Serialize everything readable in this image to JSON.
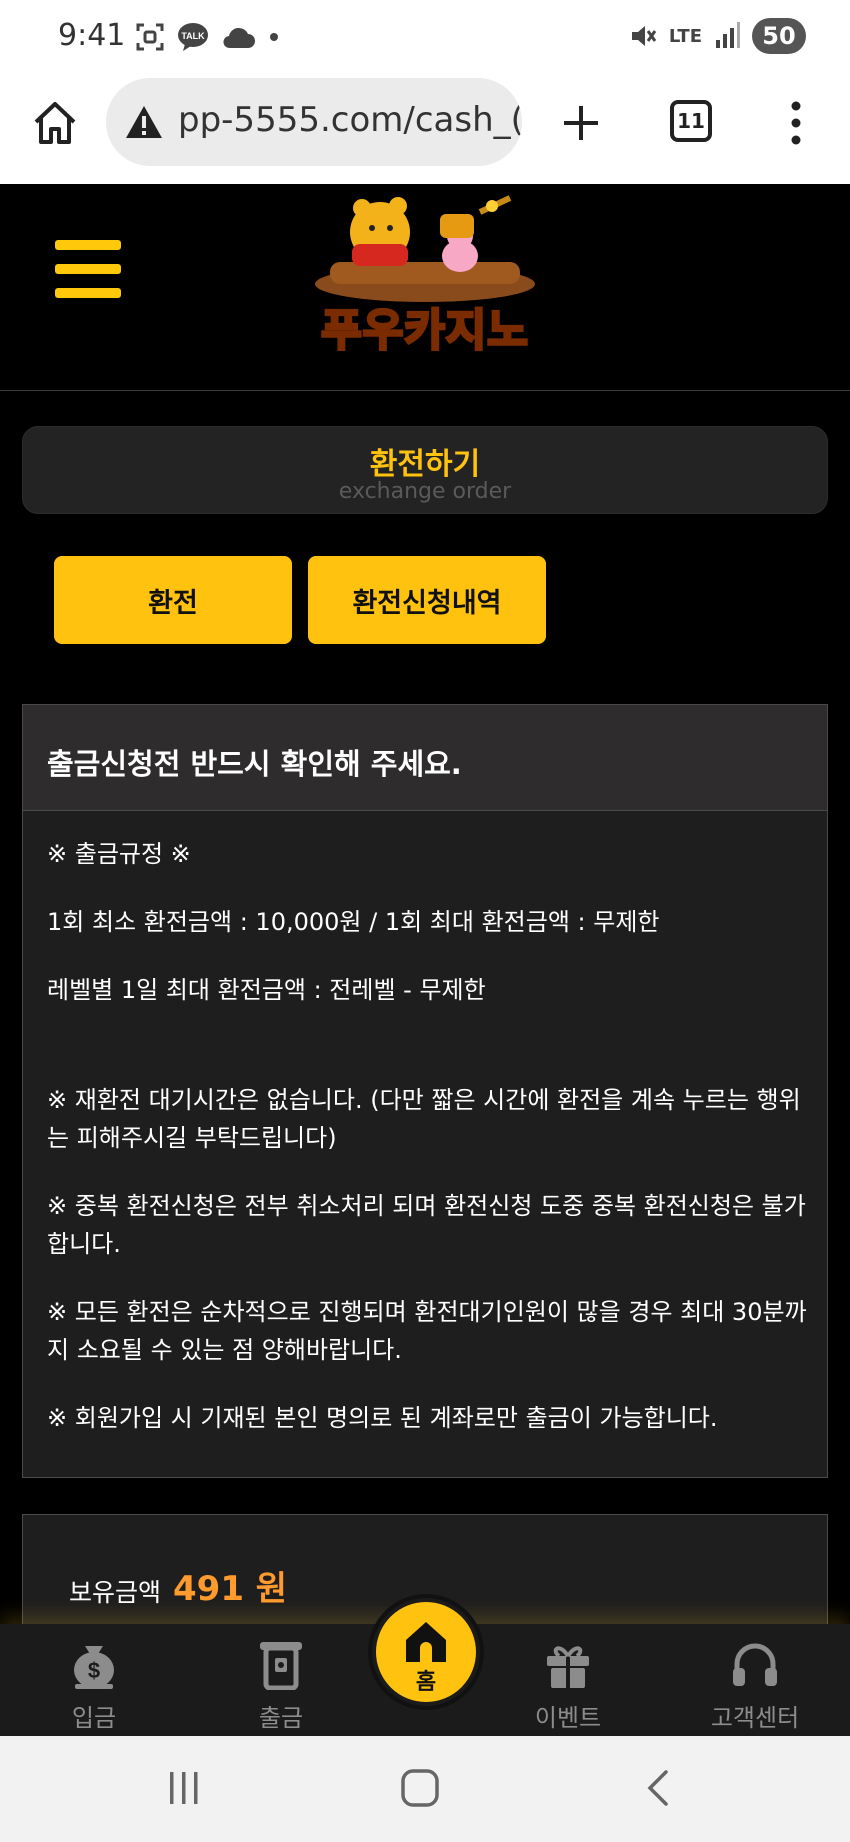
{
  "status_bar": {
    "time": "9:41",
    "talk_badge": "TALK",
    "network": "LTE",
    "battery": "50"
  },
  "browser": {
    "url": "pp-5555.com/cash_(",
    "tab_count": "11"
  },
  "site": {
    "logo_text": "푸우카지노"
  },
  "page": {
    "title": "환전하기",
    "subtitle": "exchange order"
  },
  "tabs": {
    "exchange": "환전",
    "history": "환전신청내역"
  },
  "notice": {
    "heading": "출금신청전 반드시 확인해 주세요.",
    "rules_title": "※ 출금규정 ※",
    "line_min_max": "1회 최소 환전금액 : 10,000원 / 1회 최대 환전금액 : 무제한",
    "line_daily": "레벨별 1일 최대 환전금액 : 전레벨 - 무제한",
    "line_wait": "※ 재환전 대기시간은 없습니다. (다만 짧은 시간에 환전을 계속 누르는 행위는 피해주시길 부탁드립니다)",
    "line_duplicate": "※ 중복 환전신청은 전부 취소처리 되며 환전신청 도중 중복 환전신청은 불가합니다.",
    "line_order": "※ 모든 환전은 순차적으로 진행되며 환전대기인원이 많을 경우 최대 30분까지 소요될 수 있는 점 양해바랍니다.",
    "line_account": "※ 회원가입 시 기재된 본인 명의로 된 계좌로만 출금이 가능합니다."
  },
  "balance": {
    "label": "보유금액",
    "amount": "491 원"
  },
  "bottom_nav": {
    "deposit": "입금",
    "withdraw": "출금",
    "home": "홈",
    "event": "이벤트",
    "support": "고객센터"
  },
  "colors": {
    "accent": "#ffc20e",
    "balance_amount": "#ff9b2e",
    "panel_bg": "#1e1e1e"
  }
}
